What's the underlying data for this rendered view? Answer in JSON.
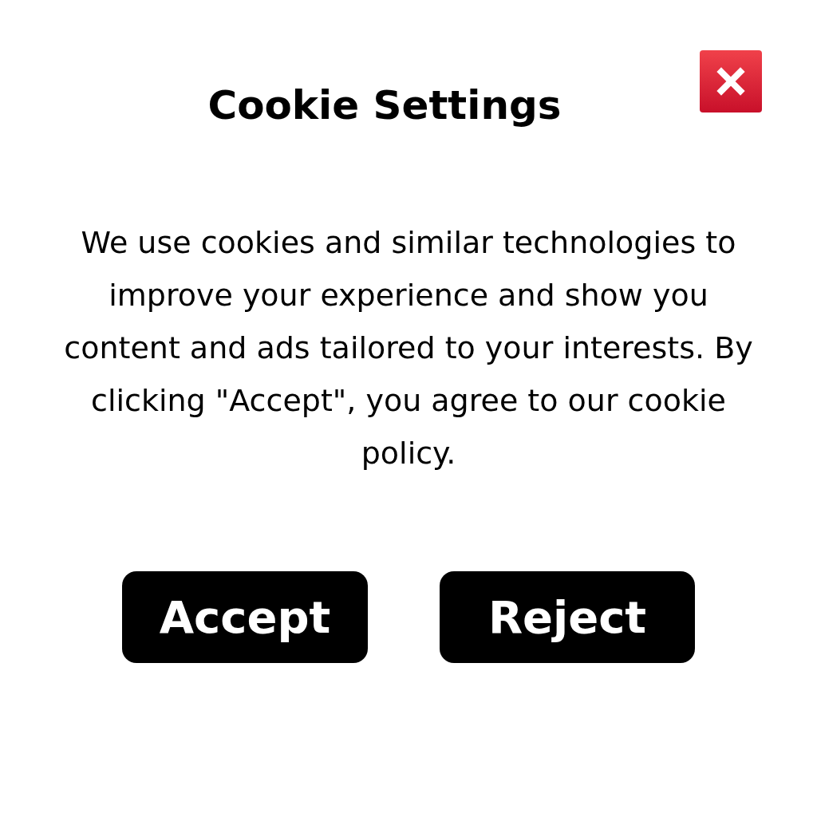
{
  "dialog": {
    "title": "Cookie Settings",
    "message": "We use cookies and similar technologies to improve your experience and show you content and ads tailored to your interests. By clicking \"Accept\", you agree to our cookie policy.",
    "buttons": [
      {
        "label": "Accept",
        "kind": "primary"
      },
      {
        "label": "Reject",
        "kind": "primary"
      }
    ]
  }
}
